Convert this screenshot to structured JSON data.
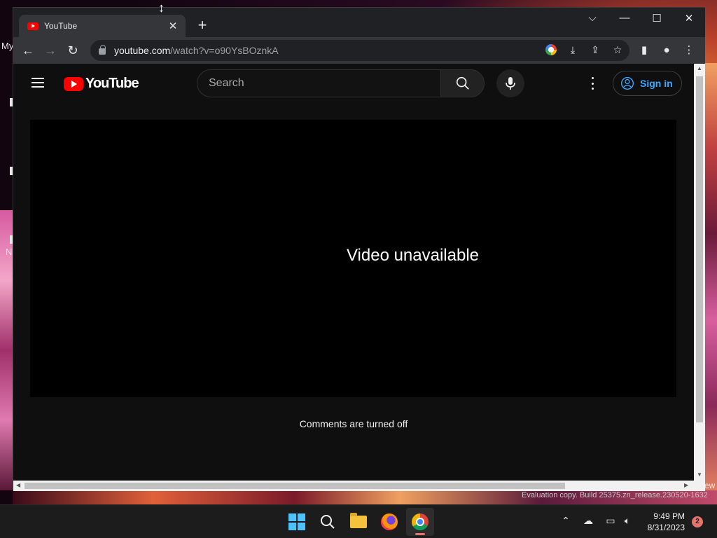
{
  "desktop": {
    "label_my": "My",
    "label_n": "N",
    "label_ew": "ew",
    "watermark": "Evaluation copy. Build 25375.zn_release.230520-1632"
  },
  "browser": {
    "tab_title": "YouTube",
    "url_host": "youtube.com",
    "url_path": "/watch?v=o90YsBOznkA"
  },
  "youtube": {
    "logo_text": "YouTube",
    "search_placeholder": "Search",
    "signin_label": "Sign in",
    "player_message": "Video unavailable",
    "comments_message": "Comments are turned off"
  },
  "taskbar": {
    "time": "9:49 PM",
    "date": "8/31/2023",
    "notification_count": "2"
  },
  "colors": {
    "yt_red": "#ff0000",
    "signin_blue": "#3ea6ff",
    "page_bg": "#0f0f0f"
  }
}
